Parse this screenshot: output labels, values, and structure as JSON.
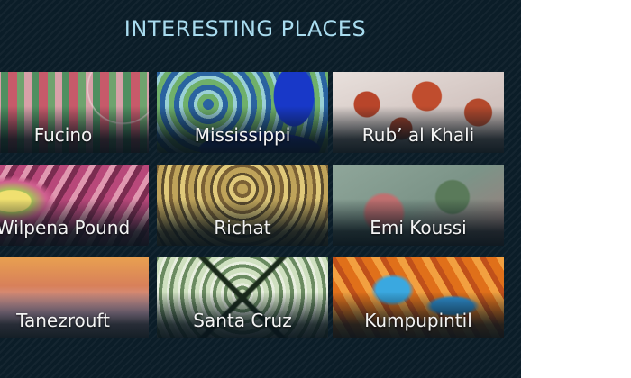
{
  "panel": {
    "title": "INTERESTING PLACES"
  },
  "places": [
    {
      "label": "Fucino"
    },
    {
      "label": "Mississippi"
    },
    {
      "label": "Rub’ al Khali"
    },
    {
      "label": "Wilpena Pound"
    },
    {
      "label": "Richat"
    },
    {
      "label": "Emi Koussi"
    },
    {
      "label": "Tanezrouft"
    },
    {
      "label": "Santa Cruz"
    },
    {
      "label": "Kumpupintil"
    }
  ]
}
